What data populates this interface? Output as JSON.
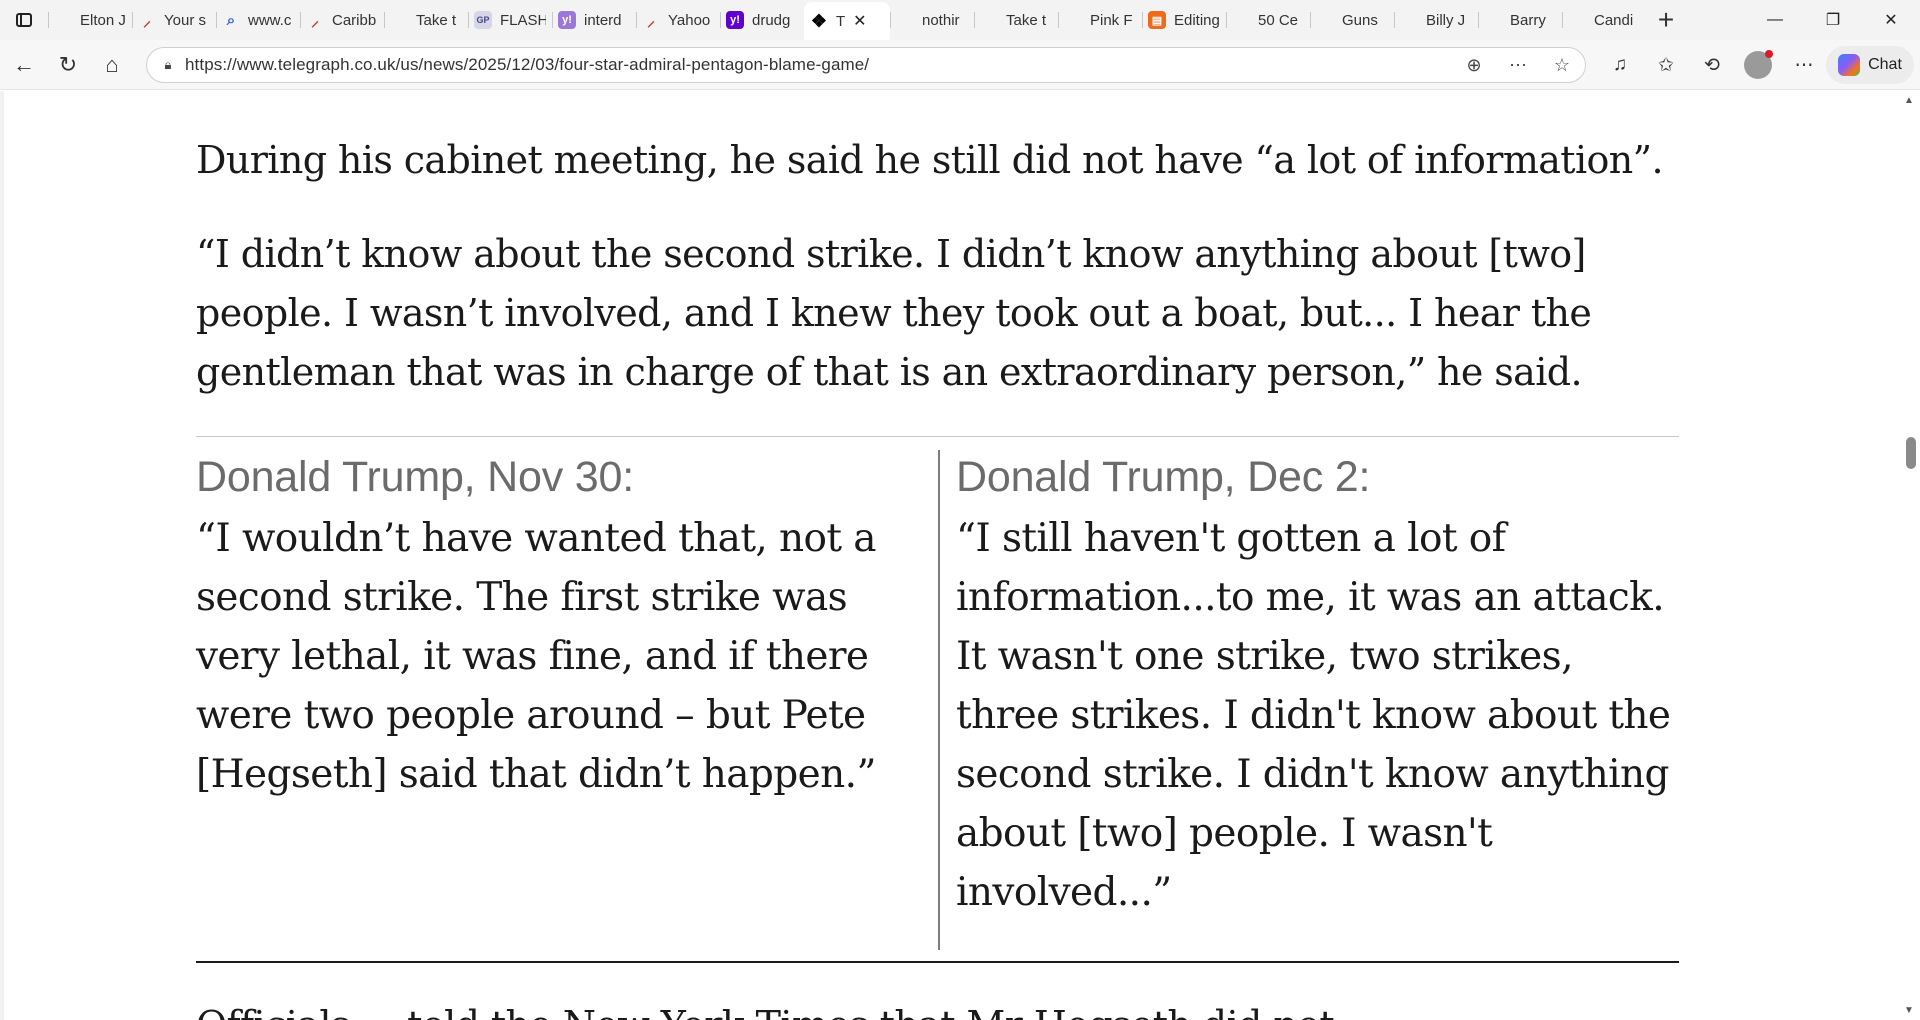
{
  "browser": {
    "tabs": [
      {
        "label": "Elton J",
        "icon": "youtube-faded"
      },
      {
        "label": "Your s",
        "icon": "feather"
      },
      {
        "label": "www.c",
        "icon": "search"
      },
      {
        "label": "Caribb",
        "icon": "feather"
      },
      {
        "label": "Take t",
        "icon": "youtube-faded"
      },
      {
        "label": "FLASH",
        "icon": "gp"
      },
      {
        "label": "interd",
        "icon": "yahoo-faded"
      },
      {
        "label": "Yahoo",
        "icon": "feather"
      },
      {
        "label": "drudg",
        "icon": "yahoo"
      },
      {
        "label": "T",
        "icon": "telegraph",
        "active": true
      },
      {
        "label": "nothir",
        "icon": "youtube"
      },
      {
        "label": "Take t",
        "icon": "youtube"
      },
      {
        "label": "Pink F",
        "icon": "youtube"
      },
      {
        "label": "Editing",
        "icon": "edit"
      },
      {
        "label": "50 Ce",
        "icon": "youtube"
      },
      {
        "label": "Guns",
        "icon": "youtube-faded"
      },
      {
        "label": "Billy J",
        "icon": "youtube-faded"
      },
      {
        "label": "Barry",
        "icon": "youtube-faded"
      },
      {
        "label": "Candi",
        "icon": "youtube-faded"
      }
    ],
    "url": "https://www.telegraph.co.uk/us/news/2025/12/03/four-star-admiral-pentagon-blame-game/",
    "chat_label": "Chat"
  },
  "article": {
    "para1": "During his cabinet meeting, he said he still did not have “a lot of information”.",
    "para2": "“I didn’t know about the second strike. I didn’t know anything about [two] people. I wasn’t involved, and I knew they took out a boat, but... I hear the gentleman that was in charge of that is an extraordinary person,” he said.",
    "quote_left": {
      "heading": "Donald Trump, Nov 30:",
      "text": "“I wouldn’t have wanted that, not a second strike. The first strike was very lethal, it was fine, and if there were two people around – but Pete [Hegseth] said that didn’t happen.”"
    },
    "quote_right": {
      "heading": "Donald Trump, Dec 2:",
      "text": "“I still haven't gotten a lot of information...to me, it was an attack. It wasn't one strike, two strikes, three strikes. I didn't know about the second strike. I didn't know anything about [two] people. I wasn't involved...”"
    },
    "cut_off_text": "Officials ... told the New York Times that Mr Hegseth did not ..."
  }
}
